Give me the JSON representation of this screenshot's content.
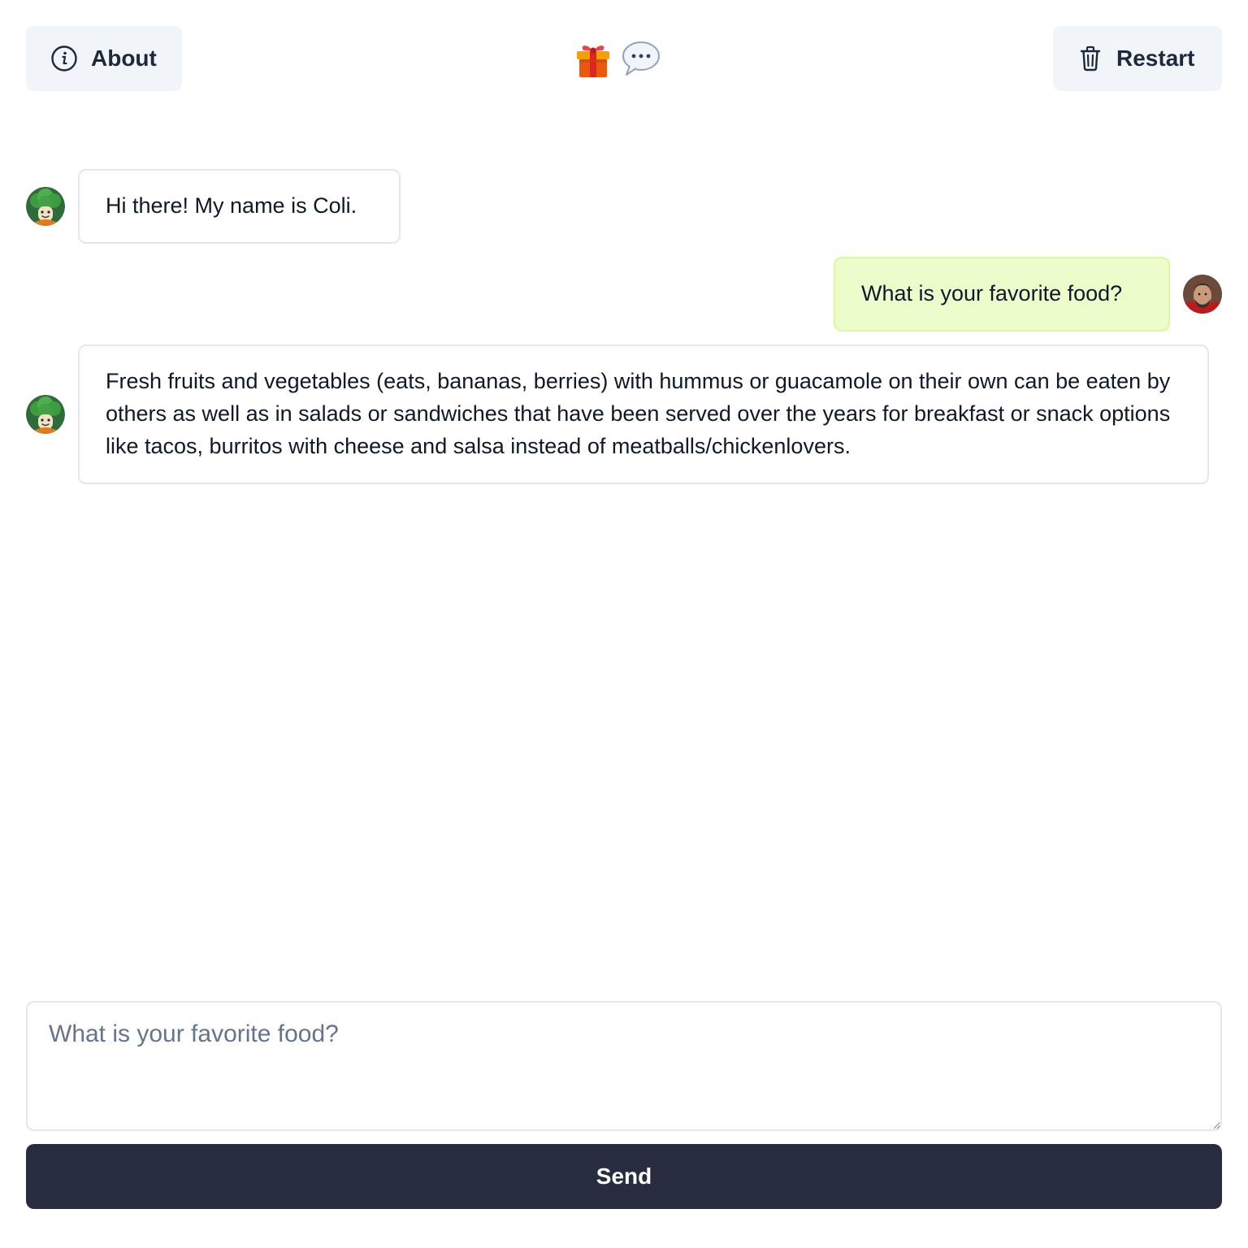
{
  "header": {
    "about_label": "About",
    "about_icon": "info-circle-icon",
    "restart_label": "Restart",
    "restart_icon": "trash-icon",
    "center_icons": [
      "gift-icon",
      "speech-bubble-icon"
    ]
  },
  "messages": [
    {
      "role": "assistant",
      "avatar": "broccoli-avatar",
      "text": "Hi there! My name is Coli."
    },
    {
      "role": "user",
      "avatar": "user-photo-avatar",
      "text": "What is your favorite food?"
    },
    {
      "role": "assistant",
      "avatar": "broccoli-avatar",
      "text": "Fresh fruits and vegetables (eats, bananas, berries) with hummus or guacamole on their own can be eaten by others as well as in salads or sandwiches that have been served over the years for breakfast or snack options like tacos, burritos with cheese and salsa instead of meatballs/chickenlovers."
    }
  ],
  "composer": {
    "value": "",
    "placeholder": "What is your favorite food?"
  },
  "send_label": "Send",
  "colors": {
    "button_bg": "#f1f5f9",
    "user_bubble": "#ecfccb",
    "send_bg": "#272c3f",
    "border": "#e5e7eb"
  }
}
